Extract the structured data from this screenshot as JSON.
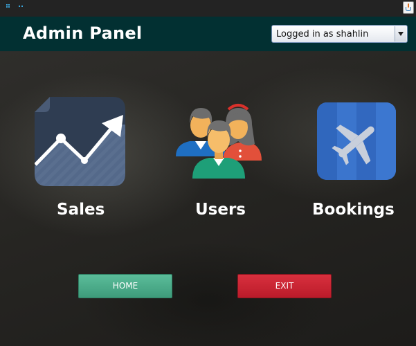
{
  "header": {
    "title": "Admin Panel",
    "user_select": {
      "value": "Logged in as shahlin"
    }
  },
  "tiles": [
    {
      "label": "Sales",
      "icon": "sales-chart-icon"
    },
    {
      "label": "Users",
      "icon": "users-group-icon"
    },
    {
      "label": "Bookings",
      "icon": "airplane-icon"
    }
  ],
  "buttons": {
    "home": "HOME",
    "exit": "EXIT"
  },
  "colors": {
    "header_bg": "#023032",
    "home_button": "#4aa888",
    "exit_button": "#c9222f",
    "sales_tile": "#4d6384",
    "bookings_tile": "#3c74c9"
  }
}
